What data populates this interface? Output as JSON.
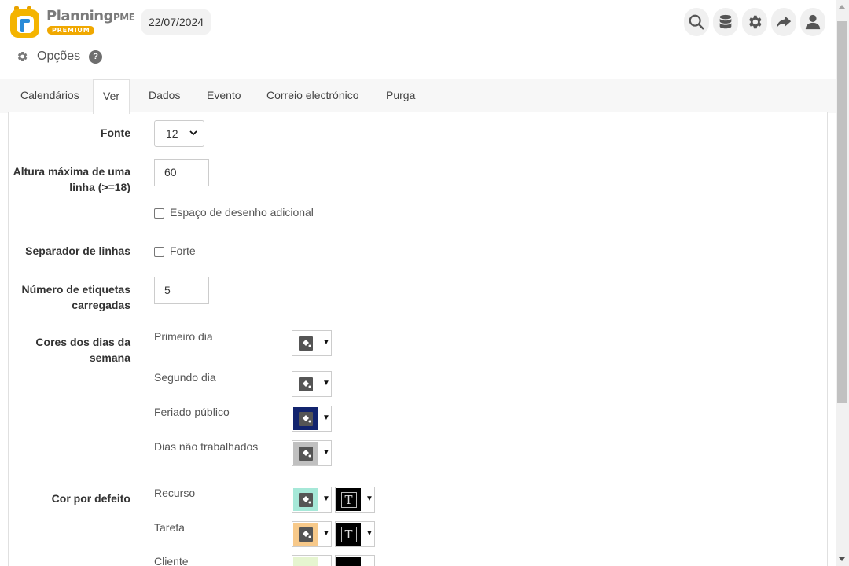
{
  "header": {
    "brand_name": "Planning",
    "brand_suffix": "PME",
    "brand_badge": "PREMIUM",
    "date": "22/07/2024",
    "icons": [
      "search-icon",
      "database-icon",
      "gear-icon",
      "share-icon",
      "user-icon"
    ]
  },
  "page": {
    "title": "Opções",
    "help": "?"
  },
  "tabs": [
    {
      "label": "Calendários",
      "active": false
    },
    {
      "label": "Ver",
      "active": true
    },
    {
      "label": "Dados",
      "active": false
    },
    {
      "label": "Evento",
      "active": false
    },
    {
      "label": "Correio electrónico",
      "active": false
    },
    {
      "label": "Purga",
      "active": false
    }
  ],
  "form": {
    "font": {
      "label": "Fonte",
      "value": "12"
    },
    "max_height": {
      "label_line1": "Altura máxima de uma",
      "label_line2": "linha (>=18)",
      "value": "60"
    },
    "extra_space": {
      "label": "Espaço de desenho adicional",
      "checked": false
    },
    "separator": {
      "label": "Separador de linhas",
      "option": "Forte",
      "checked": false
    },
    "labels_loaded": {
      "label_line1": "Número de etiquetas",
      "label_line2": "carregadas",
      "value": "5"
    },
    "weekday_colors": {
      "label_line1": "Cores dos dias da",
      "label_line2": "semana",
      "items": [
        {
          "label": "Primeiro dia",
          "color": "#ffffff"
        },
        {
          "label": "Segundo dia",
          "color": "#ffffff"
        },
        {
          "label": "Feriado público",
          "color": "#12246e"
        },
        {
          "label": "Dias não trabalhados",
          "color": "#c0c0c0"
        }
      ]
    },
    "default_color": {
      "label": "Cor por defeito",
      "items": [
        {
          "label": "Recurso",
          "color": "#a6e8d8",
          "text_color": "#000000"
        },
        {
          "label": "Tarefa",
          "color": "#f7c98a",
          "text_color": "#000000"
        },
        {
          "label": "Cliente",
          "color": "#e6f5d0",
          "text_color": "#000000"
        }
      ]
    }
  },
  "colors": {
    "accent": "#f0a800",
    "tab_bar": "#f7f7f7",
    "border": "#e0e0e0"
  }
}
